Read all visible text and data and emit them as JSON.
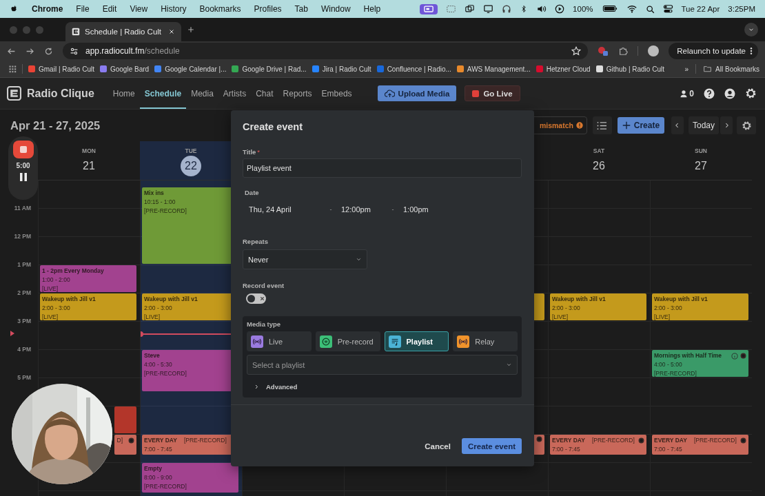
{
  "menubar": {
    "app": "Chrome",
    "menus": [
      "File",
      "Edit",
      "View",
      "History",
      "Bookmarks",
      "Profiles",
      "Tab",
      "Window",
      "Help"
    ],
    "battery": "100%",
    "date": "Tue 22 Apr",
    "time": "3:25PM"
  },
  "browser": {
    "tab": {
      "title": "Schedule | Radio Cult"
    },
    "url": {
      "host": "app.radiocult.fm",
      "path": "/schedule"
    },
    "relaunch": "Relaunch to update",
    "bookmarks": [
      {
        "label": "Gmail | Radio Cult",
        "color": "#ea4335"
      },
      {
        "label": "Google Bard",
        "color": "#8a7cf0"
      },
      {
        "label": "Google Calendar |...",
        "color": "#4285f4"
      },
      {
        "label": "Google Drive | Rad...",
        "color": "#34a853"
      },
      {
        "label": "Jira | Radio Cult",
        "color": "#2684ff"
      },
      {
        "label": "Confluence | Radio...",
        "color": "#1868db"
      },
      {
        "label": "AWS Management...",
        "color": "#e8892b"
      },
      {
        "label": "Hetzner Cloud",
        "color": "#d50c2d"
      },
      {
        "label": "Github | Radio Cult",
        "color": "#dddddd"
      }
    ],
    "overflow": "»",
    "all_bookmarks": "All Bookmarks"
  },
  "app": {
    "brand": "Radio Clique",
    "nav": [
      {
        "label": "Home",
        "selected": false
      },
      {
        "label": "Schedule",
        "selected": true
      },
      {
        "label": "Media",
        "selected": false
      },
      {
        "label": "Artists",
        "selected": false
      },
      {
        "label": "Chat",
        "selected": false
      },
      {
        "label": "Reports",
        "selected": false
      },
      {
        "label": "Embeds",
        "selected": false
      }
    ],
    "upload": "Upload Media",
    "go_live": "Go Live",
    "listeners": "0"
  },
  "toolbar": {
    "range": "Apr 21 - 27, 2025",
    "mismatch": "mismatch",
    "create": "Create",
    "today": "Today"
  },
  "recorder": {
    "time": "5:00"
  },
  "calendar": {
    "hours": [
      "11 AM",
      "12 PM",
      "1 PM",
      "2 PM",
      "3 PM",
      "4 PM",
      "5 PM"
    ],
    "days": [
      {
        "weekday": "MON",
        "date": "21",
        "today": false,
        "events": [
          {
            "kind": "stacked",
            "title": "1 - 2pm Every Monday",
            "time": "1:00 - 2:00",
            "tag": "[LIVE]",
            "color": "#a2428f"
          },
          {
            "kind": "stacked",
            "title": "Wakeup with Jill v1",
            "time": "2:00 - 3:00",
            "tag": "[LIVE]",
            "color": "#c49a1c"
          },
          {
            "kind": "block",
            "color": "#b3362a"
          },
          {
            "kind": "inline",
            "tag": "D]",
            "color": "#c9685a",
            "record_icon": true
          }
        ]
      },
      {
        "weekday": "TUE",
        "date": "22",
        "today": true,
        "events": [
          {
            "kind": "stacked",
            "title": "Mix ins",
            "time": "10:15 - 1:00",
            "tag": "[PRE-RECORD]",
            "color": "#6f9a37"
          },
          {
            "kind": "stacked",
            "title": "Wakeup with Jill v1",
            "time": "2:00 - 3:00",
            "tag": "[LIVE]",
            "color": "#c49a1c"
          },
          {
            "kind": "stacked",
            "title": "Steve",
            "time": "4:00 - 5:30",
            "tag": "[PRE-RECORD]",
            "color": "#a2428f"
          },
          {
            "kind": "inline",
            "title": "EVERY DAY",
            "time": "7:00 - 7:45",
            "tag": "[PRE-RECORD]",
            "color": "#c9685a"
          },
          {
            "kind": "stacked",
            "title": "Empty",
            "time": "8:00 - 9:00",
            "tag": "[PRE-RECORD]",
            "color": "#a2428f"
          }
        ]
      },
      {
        "events": [
          {
            "kind": "block",
            "color": "#c49a1c"
          },
          {
            "kind": "inline",
            "color": "#c9685a",
            "record_icon": true
          }
        ]
      },
      {
        "weekday": "SAT",
        "date": "26",
        "today": false,
        "events": [
          {
            "kind": "stacked",
            "title": "Wakeup with Jill v1",
            "time": "2:00 - 3:00",
            "tag": "[LIVE]",
            "color": "#c49a1c"
          },
          {
            "kind": "inline",
            "title": "EVERY DAY",
            "time": "7:00 - 7:45",
            "tag": "[PRE-RECORD]",
            "color": "#c9685a",
            "record_icon": true
          }
        ]
      },
      {
        "weekday": "SUN",
        "date": "27",
        "today": false,
        "events": [
          {
            "kind": "stacked",
            "title": "Wakeup with Jill v1",
            "time": "2:00 - 3:00",
            "tag": "[LIVE]",
            "color": "#c49a1c"
          },
          {
            "kind": "stacked",
            "title": "Mornings with Half Time",
            "time": "4:00 - 5:00",
            "tag": "[PRE-RECORD]",
            "color": "#3a9a68",
            "info_icon": true,
            "record_icon": true
          },
          {
            "kind": "inline",
            "title": "EVERY DAY",
            "time": "7:00 - 7:45",
            "tag": "[PRE-RECORD]",
            "color": "#c9685a",
            "record_icon": true
          }
        ]
      }
    ]
  },
  "dialog": {
    "title": "Create event",
    "title_field": {
      "label": "Title",
      "required_mark": "*",
      "value": "Playlist event"
    },
    "date": {
      "label": "Date",
      "day": "Thu, 24 April",
      "separators": [
        "-",
        "-"
      ],
      "start": "12:00pm",
      "end": "1:00pm"
    },
    "repeats": {
      "label": "Repeats",
      "value": "Never"
    },
    "record": {
      "label": "Record event",
      "on": false
    },
    "media": {
      "label": "Media type",
      "options": [
        {
          "label": "Live",
          "kind": "broadcast",
          "color": "#9a7be0",
          "selected": false
        },
        {
          "label": "Pre-record",
          "kind": "disc",
          "color": "#3cbf78",
          "selected": false
        },
        {
          "label": "Playlist",
          "kind": "playlist",
          "color": "#4bb3d6",
          "selected": true
        },
        {
          "label": "Relay",
          "kind": "broadcast",
          "color": "#f0932b",
          "selected": false
        }
      ],
      "playlist_placeholder": "Select a playlist",
      "advanced": {
        "label": "Advanced",
        "expanded": false
      }
    },
    "cancel": "Cancel",
    "submit": "Create event"
  }
}
